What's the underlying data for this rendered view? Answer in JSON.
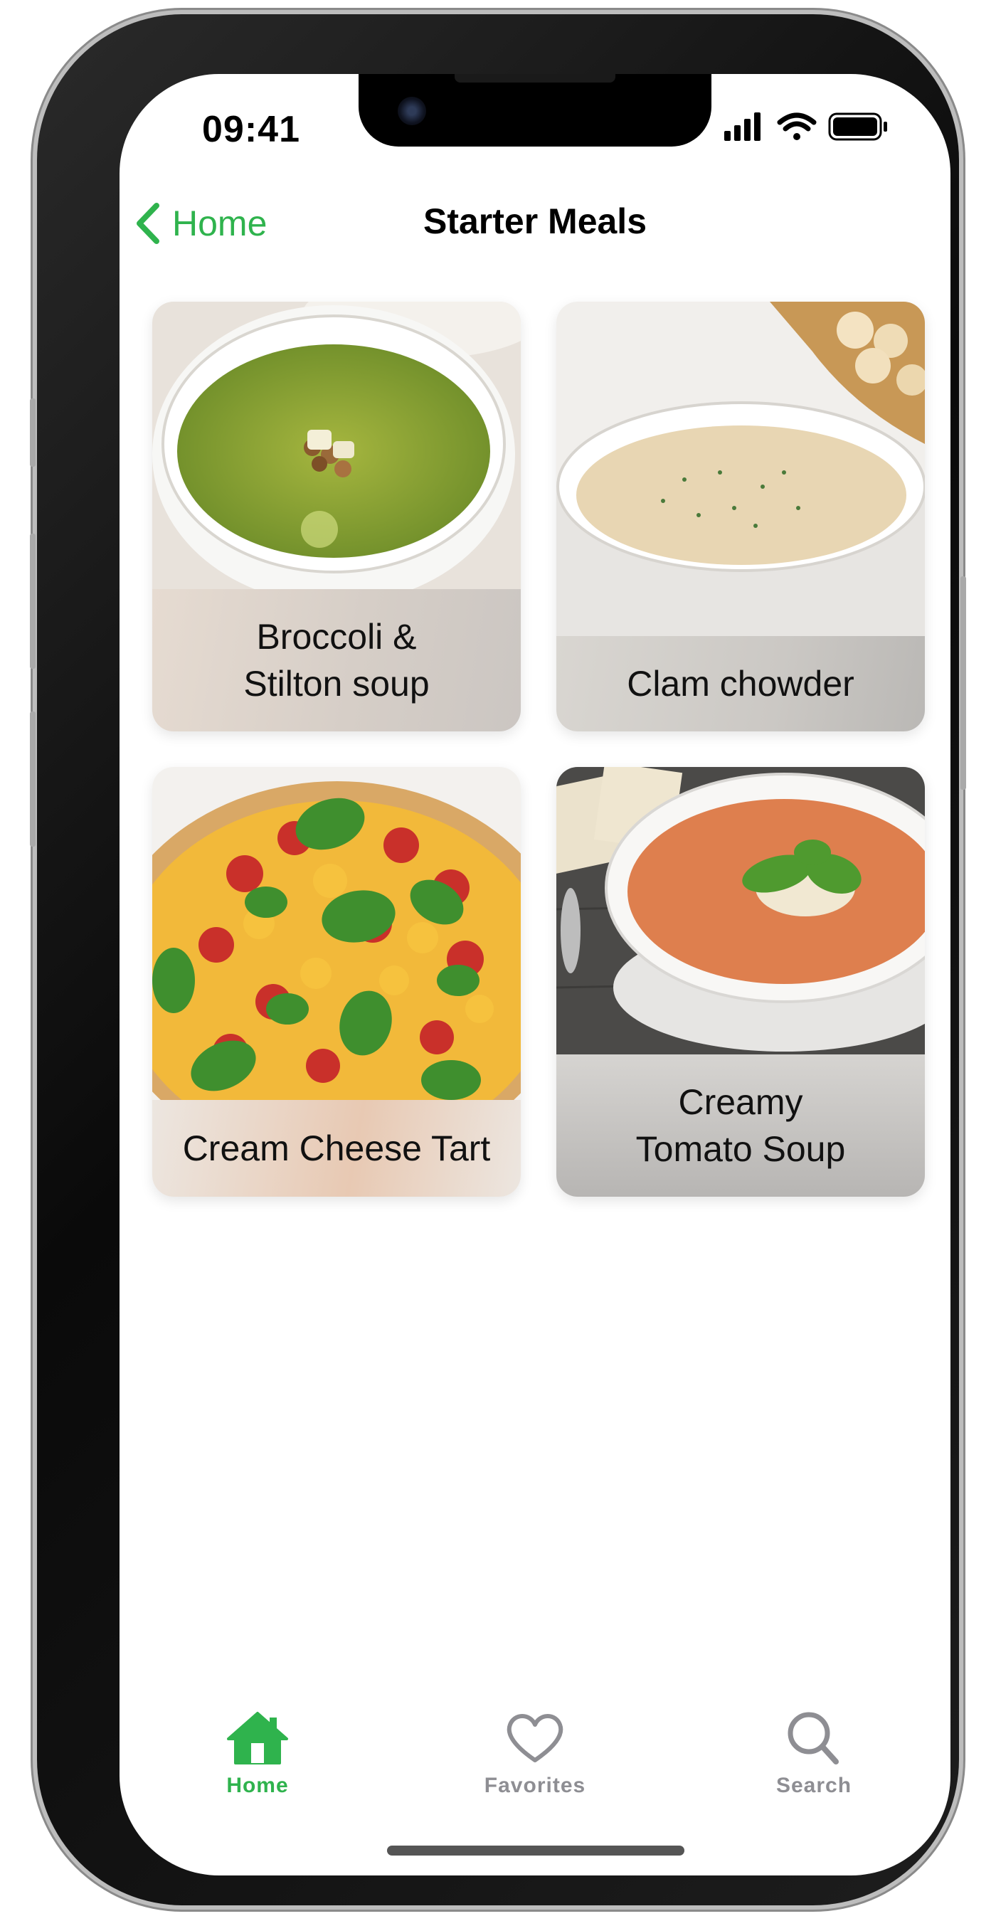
{
  "status_bar": {
    "time": "09:41"
  },
  "nav": {
    "back_label": "Home",
    "title": "Starter Meals"
  },
  "meals": [
    {
      "name_line1": "Broccoli &",
      "name_line2": "Stilton soup"
    },
    {
      "name_line1": "",
      "name_line2": "Clam chowder"
    },
    {
      "name_line1": "",
      "name_line2": "Cream Cheese Tart"
    },
    {
      "name_line1": "Creamy",
      "name_line2": "Tomato Soup"
    }
  ],
  "tab_bar": {
    "items": [
      {
        "label": "Home",
        "icon": "house-icon",
        "selected": true
      },
      {
        "label": "Favorites",
        "icon": "heart-icon",
        "selected": false
      },
      {
        "label": "Search",
        "icon": "magnifier-icon",
        "selected": false
      }
    ]
  },
  "colors": {
    "accent": "#2fb34d",
    "inactive": "#8e8e93"
  }
}
